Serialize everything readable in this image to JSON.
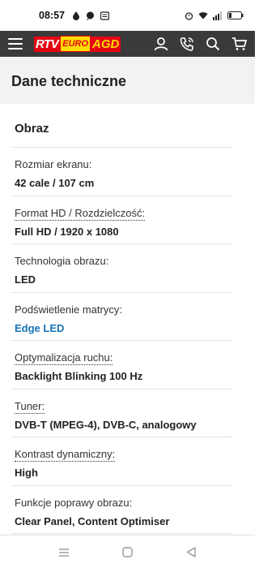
{
  "status_bar": {
    "time": "08:57",
    "icons_left": [
      "drop-icon",
      "chat-icon",
      "message-icon"
    ],
    "icons_right": [
      "alarm-icon",
      "wifi-icon",
      "signal-icon",
      "battery-icon"
    ]
  },
  "header": {
    "logo": {
      "part1": "RTV",
      "part2": "EURO",
      "part3": "AGD"
    },
    "icons": [
      "menu-icon",
      "user-icon",
      "phone-icon",
      "search-icon",
      "cart-icon"
    ]
  },
  "page": {
    "title": "Dane techniczne",
    "section": "Obraz",
    "rows": [
      {
        "label": "Rozmiar ekranu:",
        "value": "42 cale / 107 cm",
        "dotted": false,
        "link": false
      },
      {
        "label": "Format HD / Rozdzielczość:",
        "value": "Full HD / 1920 x 1080",
        "dotted": true,
        "link": false
      },
      {
        "label": "Technologia obrazu:",
        "value": "LED",
        "dotted": false,
        "link": false
      },
      {
        "label": "Podświetlenie matrycy:",
        "value": "Edge LED",
        "dotted": false,
        "link": true
      },
      {
        "label": "Optymalizacja ruchu:",
        "value": "Backlight Blinking 100 Hz",
        "dotted": true,
        "link": false
      },
      {
        "label": "Tuner:",
        "value": "DVB-T (MPEG-4), DVB-C, analogowy",
        "dotted": true,
        "link": false
      },
      {
        "label": "Kontrast dynamiczny:",
        "value": "High",
        "dotted": true,
        "link": false
      },
      {
        "label": "Funkcje poprawy obrazu:",
        "value": "Clear Panel, Content Optimiser",
        "dotted": false,
        "link": false
      }
    ]
  },
  "nav_bar": {
    "icons": [
      "recents-icon",
      "home-icon",
      "back-icon"
    ]
  },
  "colors": {
    "header_bg": "#3a3a3a",
    "link": "#1673b9",
    "brand_red": "#e30613",
    "brand_yellow": "#ffdd00"
  }
}
